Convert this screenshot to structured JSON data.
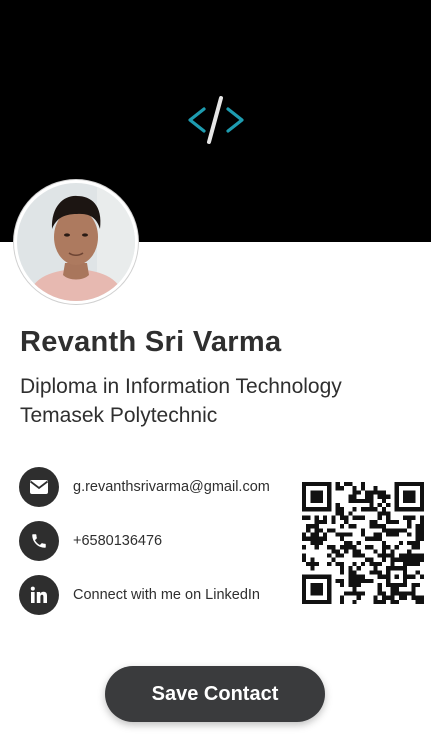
{
  "profile": {
    "name": "Revanth Sri Varma",
    "subtitle_line1": "Diploma in Information Technology",
    "subtitle_line2": "Temasek Polytechnic",
    "logo_icon": "code-brackets-icon",
    "accent_color": "#1e9cb0"
  },
  "contacts": [
    {
      "icon": "envelope-icon",
      "label": "g.revanthsrivarma@gmail.com"
    },
    {
      "icon": "phone-icon",
      "label": "+6580136476"
    },
    {
      "icon": "linkedin-icon",
      "label": "Connect with me on LinkedIn"
    }
  ],
  "actions": {
    "save_label": "Save Contact"
  }
}
